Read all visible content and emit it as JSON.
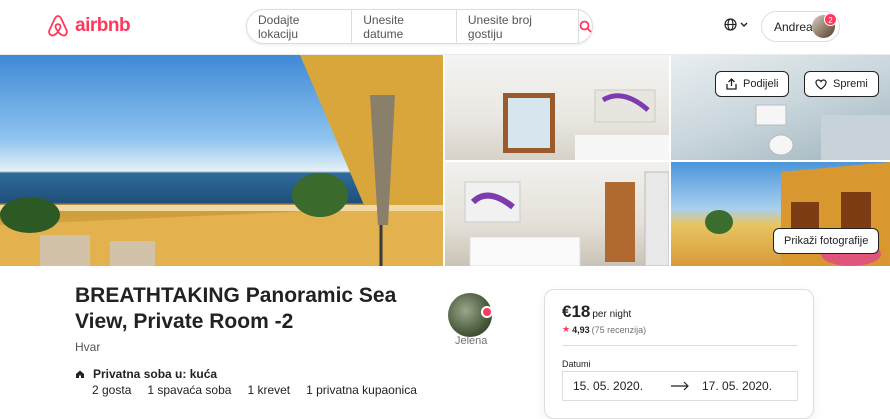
{
  "header": {
    "logo_text": "airbnb",
    "search": {
      "location": "Dodajte lokaciju",
      "dates": "Unesite datume",
      "guests": "Unesite broj gostiju"
    },
    "user": {
      "name": "Andrea",
      "notifications": "2"
    },
    "icons": {
      "brand": "airbnb-logo-icon",
      "search": "search-icon",
      "globe": "globe-icon",
      "menu": "chevron-down-icon"
    },
    "accent": "#ff385c"
  },
  "gallery": {
    "share_label": "Podijeli",
    "save_label": "Spremi",
    "show_photos_label": "Prikaži fotografije"
  },
  "listing": {
    "title": "BREATHTAKING Panoramic Sea View, Private Room -2",
    "location": "Hvar",
    "host_name": "Jelena",
    "room_type": "Privatna soba u: kuća",
    "details": [
      "2 gosta",
      "1 spavaća soba",
      "1 krevet",
      "1 privatna kupaonica"
    ]
  },
  "booking": {
    "price": "€18",
    "per_night": "per night",
    "rating": "4,93",
    "reviews": "(75 recenzija)",
    "dates_label": "Datumi",
    "check_in": "15. 05. 2020.",
    "check_out": "17. 05. 2020."
  }
}
